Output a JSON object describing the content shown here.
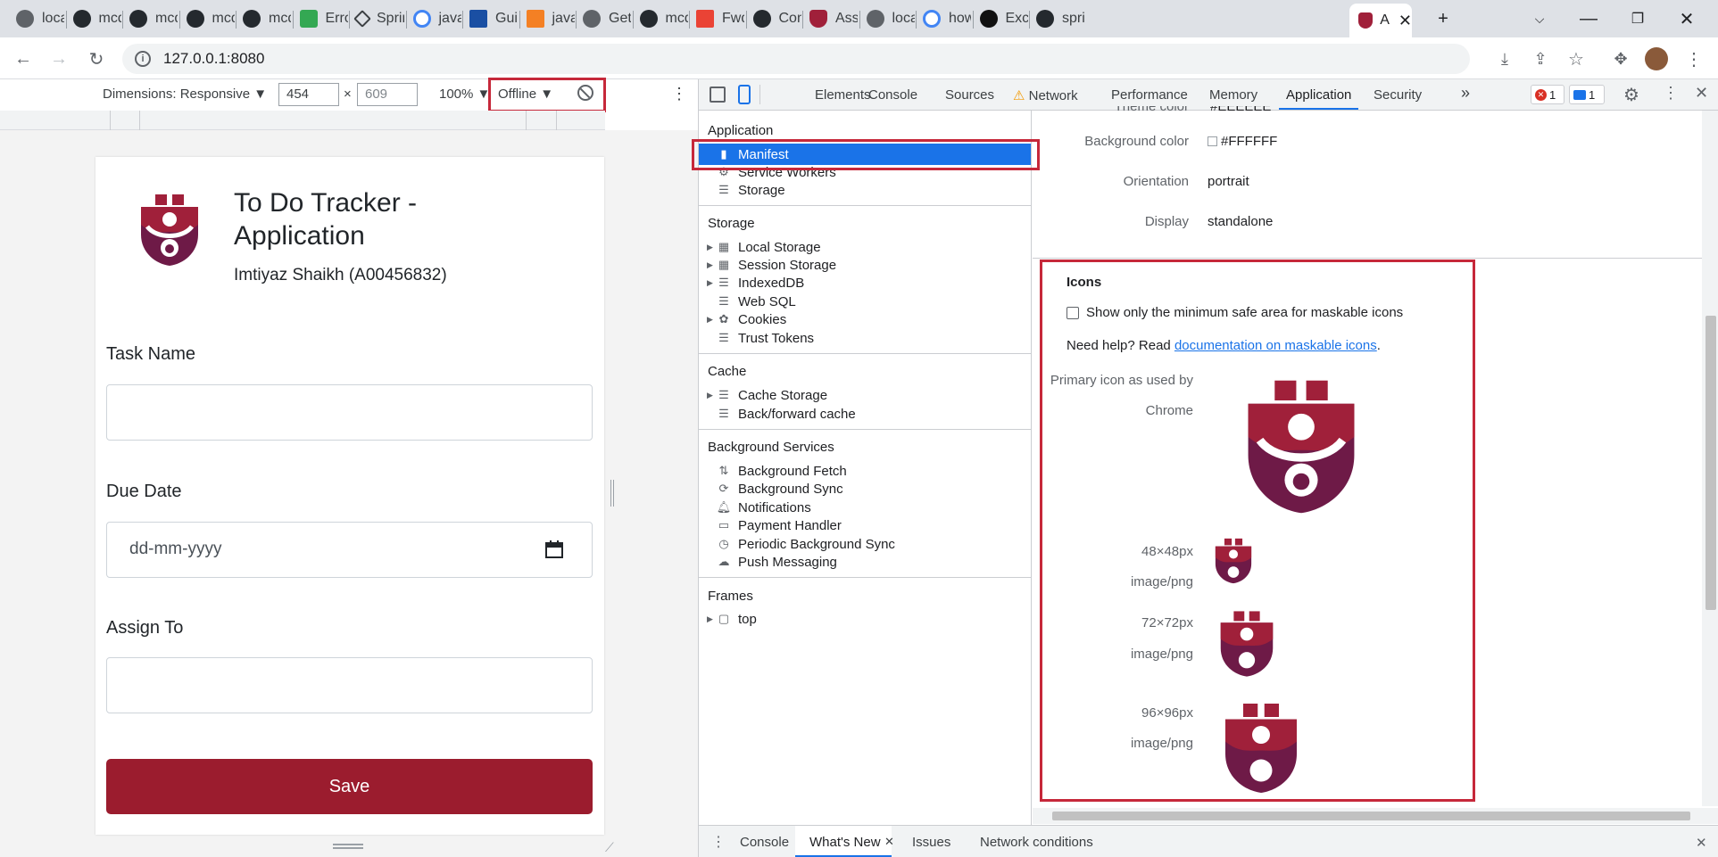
{
  "browser": {
    "tabs": [
      {
        "label": "local",
        "icon": "globe-icon"
      },
      {
        "label": "mcd",
        "icon": "github-icon"
      },
      {
        "label": "mcd",
        "icon": "github-icon"
      },
      {
        "label": "mcd",
        "icon": "github-icon"
      },
      {
        "label": "mcd",
        "icon": "github-icon"
      },
      {
        "label": "Erro",
        "icon": "green-page-icon"
      },
      {
        "label": "Sprin",
        "icon": "spring-diamond-icon"
      },
      {
        "label": "java",
        "icon": "google-icon"
      },
      {
        "label": "Guic",
        "icon": "blue-bookmark-icon"
      },
      {
        "label": "java",
        "icon": "stackoverflow-icon"
      },
      {
        "label": "Get",
        "icon": "globe-icon"
      },
      {
        "label": "mcd",
        "icon": "github-icon"
      },
      {
        "label": "Fwd",
        "icon": "gmail-icon"
      },
      {
        "label": "Con",
        "icon": "github-icon"
      },
      {
        "label": "Assi",
        "icon": "shield-icon"
      },
      {
        "label": "local",
        "icon": "globe-icon"
      },
      {
        "label": "how",
        "icon": "google-icon"
      },
      {
        "label": "Exce",
        "icon": "dark-circle-icon"
      },
      {
        "label": "sprin",
        "icon": "github-icon"
      }
    ],
    "active_tab_label": "A",
    "new_tab": "+",
    "url": "127.0.0.1:8080"
  },
  "device_toolbar": {
    "dimensions_label": "Dimensions: Responsive ▼",
    "width": "454",
    "times": "×",
    "height": "609",
    "zoom": "100% ▼",
    "throttle": "Offline ▼",
    "more": "⋮"
  },
  "app": {
    "title": "To Do Tracker - Application",
    "subtitle": "Imtiyaz Shaikh (A00456832)",
    "task_label": "Task Name",
    "due_label": "Due Date",
    "due_placeholder": "dd-mm-yyyy",
    "assign_label": "Assign To",
    "save_label": "Save"
  },
  "devtools": {
    "tabs": [
      "Elements",
      "Console",
      "Sources",
      "Network",
      "Performance",
      "Memory",
      "Application",
      "Security"
    ],
    "active_tab": "Application",
    "more_tabs": "»",
    "error_count": "1",
    "message_count": "1",
    "sidebar": {
      "application_header": "Application",
      "application_items": [
        "Manifest",
        "Service Workers",
        "Storage"
      ],
      "storage_header": "Storage",
      "storage_items": [
        "Local Storage",
        "Session Storage",
        "IndexedDB",
        "Web SQL",
        "Cookies",
        "Trust Tokens"
      ],
      "cache_header": "Cache",
      "cache_items": [
        "Cache Storage",
        "Back/forward cache"
      ],
      "bg_header": "Background Services",
      "bg_items": [
        "Background Fetch",
        "Background Sync",
        "Notifications",
        "Payment Handler",
        "Periodic Background Sync",
        "Push Messaging"
      ],
      "frames_header": "Frames",
      "frames_items": [
        "top"
      ]
    },
    "manifest": {
      "theme_color_label": "Theme color",
      "theme_color_value": "#EEEEEE",
      "background_color_label": "Background color",
      "background_color_value": "#FFFFFF",
      "orientation_label": "Orientation",
      "orientation_value": "portrait",
      "display_label": "Display",
      "display_value": "standalone",
      "icons_header": "Icons",
      "maskable_checkbox_label": "Show only the minimum safe area for maskable icons",
      "help_prefix": "Need help? Read ",
      "help_link": "documentation on maskable icons",
      "help_suffix": ".",
      "primary_icon_label_1": "Primary icon as used by",
      "primary_icon_label_2": "Chrome",
      "icon_entries": [
        {
          "size": "48×48px",
          "type": "image/png"
        },
        {
          "size": "72×72px",
          "type": "image/png"
        },
        {
          "size": "96×96px",
          "type": "image/png"
        }
      ]
    },
    "drawer": {
      "tabs": [
        "Console",
        "What's New",
        "Issues",
        "Network conditions"
      ],
      "active_tab": "What's New"
    }
  },
  "colors": {
    "brand": "#9b1c2e",
    "logo_crimson": "#a0203a",
    "logo_plum": "#6e1a47",
    "highlight_red": "#c6283a",
    "selection_blue": "#1a73e8"
  }
}
